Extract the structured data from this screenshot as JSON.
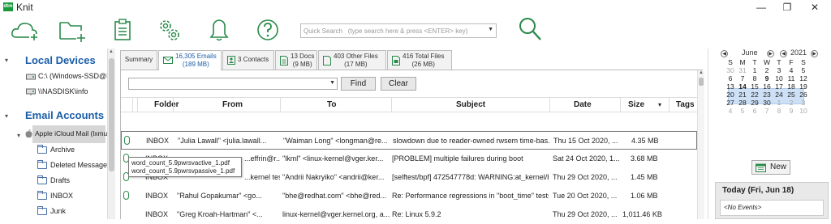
{
  "window": {
    "app_icon": "dtm",
    "title": "Knit",
    "minimize": "—",
    "restore": "❐",
    "close": "✕"
  },
  "toolbar": {
    "icons": [
      "cloud-add-icon",
      "folder-add-icon",
      "clipboard-icon",
      "gears-icon",
      "bell-icon",
      "help-icon",
      "search-go-icon"
    ],
    "search_placeholder": "Quick Search   (type search here & press <ENTER> key)"
  },
  "sidebar": {
    "local_devices": "Local Devices",
    "devices": [
      "C:\\ (Windows-SSD@RS",
      "\\\\NASDISK\\info"
    ],
    "email_accounts": "Email Accounts",
    "account": "Apple iCloud Mail (lxmus",
    "folders": [
      "Archive",
      "Deleted Messages",
      "Drafts",
      "INBOX",
      "Junk"
    ]
  },
  "tabs": [
    {
      "label": "Summary"
    },
    {
      "label": "16,305 Emails",
      "sub": "(189 MB)"
    },
    {
      "label": "3 Contacts",
      "sub": ""
    },
    {
      "label": "13 Docs",
      "sub": "(9 MB)"
    },
    {
      "label": "403 Other Files",
      "sub": "(17 MB)"
    },
    {
      "label": "416 Total Files",
      "sub": "(26 MB)"
    }
  ],
  "filter": {
    "find": "Find",
    "clear": "Clear"
  },
  "columns": {
    "folder": "Folder",
    "from": "From",
    "to": "To",
    "subject": "Subject",
    "date": "Date",
    "size": "Size",
    "tags": "Tags",
    "sort_indicator": "▾"
  },
  "rows": [
    {
      "folder": "INBOX",
      "from": "\"Julia Lawall\" <julia.lawall...",
      "to": "\"Waiman Long\" <longman@re...",
      "subject": "slowdown due to reader-owned rwsem time-bas...",
      "date": "Thu 15 Oct 2020, ...",
      "size": "4.35 MB"
    },
    {
      "folder": "INBOX",
      "from": "...effrin@r...",
      "to": "\"lkml\" <linux-kernel@vger.ker...",
      "subject": "[PROBLEM]  multiple failures  during boot",
      "date": "Sat 24 Oct 2020, 1...",
      "size": "3.68 MB"
    },
    {
      "folder": "INBOX",
      "from": "...kernel test robot\" <lkp@...",
      "to": "\"Andrii Nakryiko\" <andrii@ker...",
      "subject": "[selftest/bpf] 472547778d: WARNING:at_kernel/b...",
      "date": "Thu 29 Oct 2020, ...",
      "size": "1.45 MB"
    },
    {
      "folder": "INBOX",
      "from": "\"Rahul Gopakumar\" <go...",
      "to": "\"bhe@redhat.com\" <bhe@red...",
      "subject": "Re: Performance regressions in \"boot_time\" tests...",
      "date": "Tue 20 Oct 2020, ...",
      "size": "1.06 MB"
    },
    {
      "folder": "INBOX",
      "from": "\"Greg Kroah-Hartman\" <...",
      "to": "linux-kernel@vger.kernel.org, a...",
      "subject": "Re: Linux 5.9.2",
      "date": "Thu 29 Oct 2020, ...",
      "size": "1,011.46 KB"
    }
  ],
  "tooltip": [
    "word_count_5.9pwrsvactive_1.pdf",
    "word_count_5.9pwrsvpassive_1.pdf"
  ],
  "calendar": {
    "month": "June",
    "year": "2021",
    "dow": [
      "S",
      "M",
      "T",
      "W",
      "T",
      "F",
      "S"
    ],
    "weeks": [
      [
        "30",
        "31",
        "1",
        "2",
        "3",
        "4",
        "5"
      ],
      [
        "6",
        "7",
        "8",
        "9",
        "10",
        "11",
        "12"
      ],
      [
        "13",
        "14",
        "15",
        "16",
        "17",
        "18",
        "19"
      ],
      [
        "20",
        "21",
        "22",
        "23",
        "24",
        "25",
        "26"
      ],
      [
        "27",
        "28",
        "29",
        "30",
        "1",
        "2",
        "3"
      ],
      [
        "4",
        "5",
        "6",
        "7",
        "8",
        "9",
        "10"
      ]
    ]
  },
  "new_button": "New",
  "today": {
    "title": "Today (Fri, Jun 18)",
    "events": "<No Events>"
  },
  "colors": {
    "accent": "#1a5da8",
    "icon_green": "#2a8a4a",
    "selection": "#cde0f5"
  }
}
